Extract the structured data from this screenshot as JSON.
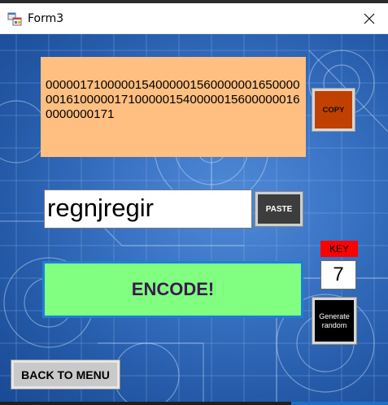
{
  "window": {
    "title": "Form3",
    "icon": "winforms-app-icon",
    "close_icon": "close-icon"
  },
  "output": {
    "text": "000001710000015400000156000000165000000161000001710000015400000156000000160000000171"
  },
  "copy_button": {
    "label": "COPY",
    "color": "#c04000"
  },
  "input": {
    "value": "regnjregir"
  },
  "paste_button": {
    "label": "PASTE",
    "color": "#3d3d3d"
  },
  "key": {
    "label": "KEY",
    "value": "7",
    "label_color": "#ff0000"
  },
  "encode_button": {
    "label": "ENCODE!",
    "color": "#80ff80",
    "border_color": "#1e7fd6"
  },
  "generate_button": {
    "label": "Generate random",
    "color": "#000000"
  },
  "back_button": {
    "label": "BACK TO MENU",
    "color": "#c9c9c9"
  },
  "colors": {
    "output_bg": "#ffbf80",
    "background": "#3a73c4"
  }
}
